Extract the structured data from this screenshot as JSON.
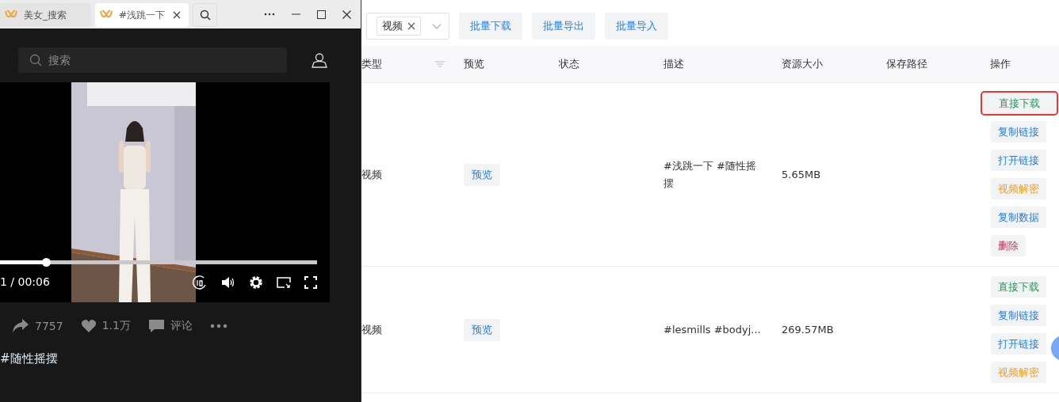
{
  "browser": {
    "tabs": [
      {
        "label": "美女_搜索",
        "selected": false,
        "closable": false
      },
      {
        "label": "#浅跳一下",
        "selected": true,
        "closable": true
      }
    ]
  },
  "search": {
    "placeholder": "搜索"
  },
  "video": {
    "kind": "picture",
    "progress": {
      "level": 0.145
    },
    "time": "1 / 00:06"
  },
  "stats": [
    {
      "kind": "share",
      "label": "7757"
    },
    {
      "kind": "like",
      "label": "1.1万"
    },
    {
      "kind": "comment",
      "label": "评论"
    }
  ],
  "caption": "#随性摇摆",
  "filter": {
    "tags": [
      "视频"
    ]
  },
  "toolbar_buttons": [
    "批量下载",
    "批量导出",
    "批量导入"
  ],
  "table": {
    "columns": [
      {
        "label": "类型",
        "filter": true
      },
      {
        "label": "预览",
        "filter": false
      },
      {
        "label": "状态",
        "filter": false
      },
      {
        "label": "描述",
        "filter": false
      },
      {
        "label": "资源大小",
        "filter": false
      },
      {
        "label": "保存路径",
        "filter": false
      },
      {
        "label": "操作",
        "filter": false
      }
    ],
    "rows": [
      {
        "type": "视频",
        "preview": "预览",
        "description": "#浅跳一下 #随性摇摆",
        "size": "5.65MB",
        "actions": [
          {
            "label": "直接下载",
            "kind": "download",
            "highlighted": true
          },
          {
            "label": "复制链接",
            "kind": "link",
            "highlighted": false
          },
          {
            "label": "打开链接",
            "kind": "link",
            "highlighted": false
          },
          {
            "label": "视频解密",
            "kind": "decrypt",
            "highlighted": false
          },
          {
            "label": "复制数据",
            "kind": "link",
            "highlighted": false
          },
          {
            "label": "删除",
            "kind": "delete",
            "highlighted": false
          }
        ]
      },
      {
        "type": "视频",
        "preview": "预览",
        "description": "#lesmills #bodyj...",
        "size": "269.57MB",
        "actions": [
          {
            "label": "直接下载",
            "kind": "download",
            "highlighted": false
          },
          {
            "label": "复制链接",
            "kind": "link",
            "highlighted": false
          },
          {
            "label": "打开链接",
            "kind": "link",
            "highlighted": false
          },
          {
            "label": "视频解密",
            "kind": "decrypt",
            "highlighted": false
          }
        ]
      }
    ]
  }
}
